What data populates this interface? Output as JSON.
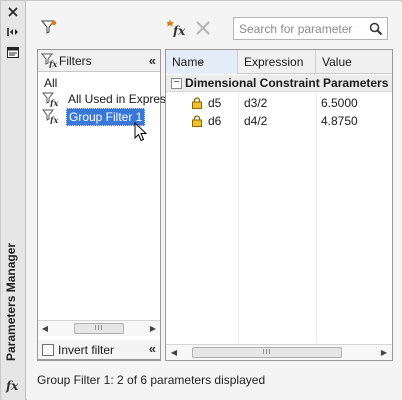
{
  "palette": {
    "selection": "#3a78d8",
    "frame": "#f4f4f4",
    "fx_orange": "#e07a10"
  },
  "sidebar": {
    "title": "Parameters Manager",
    "fx_label": "fx",
    "icons": [
      "close-icon",
      "auto-hide-icon",
      "properties-icon",
      "fx-icon"
    ]
  },
  "toolbar": {
    "filter_icon": "funnel-icon",
    "new_param_icon": "new-user-parameter-icon",
    "delete_icon": "delete-icon",
    "search_placeholder": "Search for parameter",
    "search_icon": "search-icon"
  },
  "filters": {
    "header_label": "Filters",
    "collapse_glyph": "«",
    "items": [
      {
        "label": "All",
        "icon": "none"
      },
      {
        "label": "All Used in Expres",
        "icon": "filter-fx-icon"
      },
      {
        "label": "Group Filter 1",
        "icon": "filter-fx-icon",
        "selected": true
      }
    ],
    "scroll_thumb": "III"
  },
  "invert": {
    "label": "Invert filter",
    "checked": false,
    "collapse_glyph": "«"
  },
  "grid": {
    "columns": [
      "Name",
      "Expression",
      "Value"
    ],
    "group_toggle": "−",
    "group_label": "Dimensional Constraint Parameters",
    "rows": [
      {
        "name": "d5",
        "expression": "d3/2",
        "value": "6.5000",
        "icon": "lock-icon"
      },
      {
        "name": "d6",
        "expression": "d4/2",
        "value": "4.8750",
        "icon": "lock-icon"
      }
    ],
    "scroll_thumb": "III"
  },
  "status": "Group Filter 1: 2 of 6 parameters displayed"
}
